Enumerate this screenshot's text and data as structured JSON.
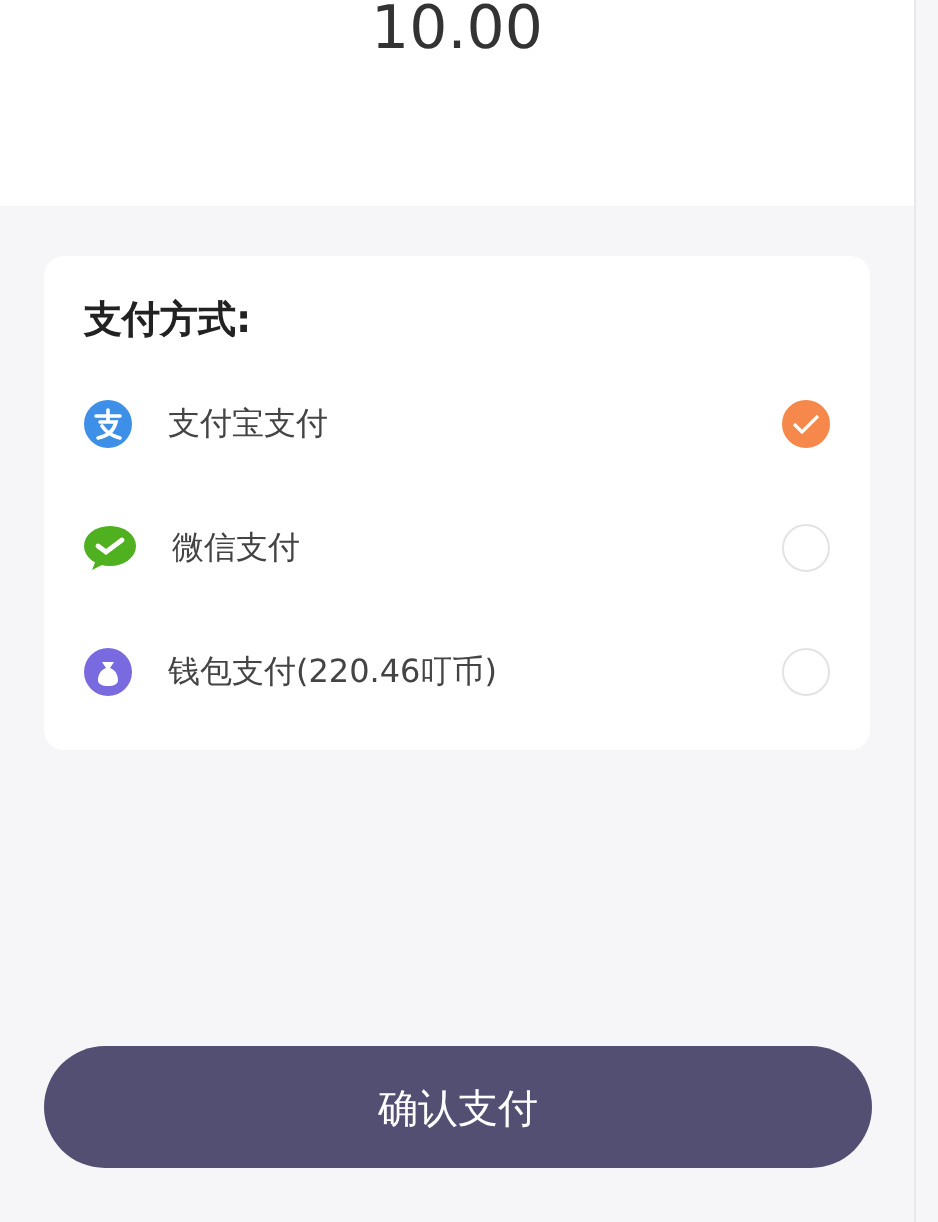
{
  "amount": "10.00",
  "payment": {
    "title": "支付方式:",
    "methods": [
      {
        "kind": "alipay",
        "label": "支付宝支付",
        "selected": true
      },
      {
        "kind": "wechat",
        "label": "微信支付",
        "selected": false
      },
      {
        "kind": "wallet",
        "label": "钱包支付(220.46叮币)",
        "selected": false
      }
    ]
  },
  "confirm_button": "确认支付"
}
